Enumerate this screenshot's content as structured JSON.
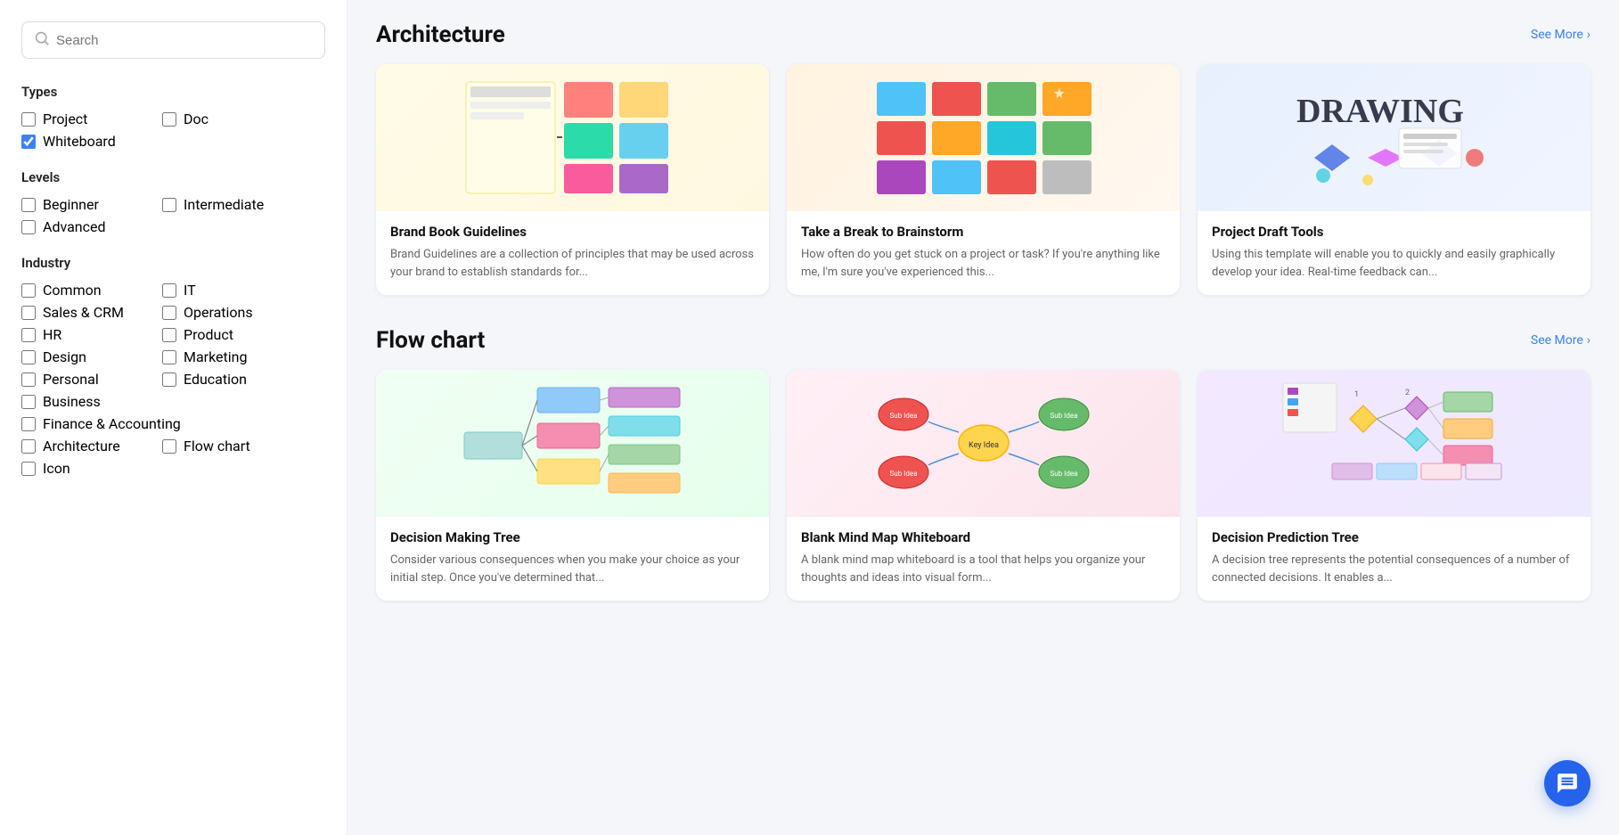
{
  "search": {
    "placeholder": "Search"
  },
  "sidebar": {
    "types_title": "Types",
    "levels_title": "Levels",
    "industry_title": "Industry",
    "types": [
      {
        "id": "project",
        "label": "Project",
        "checked": false
      },
      {
        "id": "doc",
        "label": "Doc",
        "checked": false
      },
      {
        "id": "whiteboard",
        "label": "Whiteboard",
        "checked": true
      }
    ],
    "levels": [
      {
        "id": "beginner",
        "label": "Beginner",
        "checked": false
      },
      {
        "id": "intermediate",
        "label": "Intermediate",
        "checked": false
      },
      {
        "id": "advanced",
        "label": "Advanced",
        "checked": false
      }
    ],
    "industry_col1": [
      {
        "id": "common",
        "label": "Common",
        "checked": false
      },
      {
        "id": "sales_crm",
        "label": "Sales & CRM",
        "checked": false
      },
      {
        "id": "hr",
        "label": "HR",
        "checked": false
      },
      {
        "id": "design",
        "label": "Design",
        "checked": false
      },
      {
        "id": "personal",
        "label": "Personal",
        "checked": false
      },
      {
        "id": "business",
        "label": "Business",
        "checked": false
      },
      {
        "id": "finance",
        "label": "Finance & Accounting",
        "checked": false
      },
      {
        "id": "architecture",
        "label": "Architecture",
        "checked": false
      },
      {
        "id": "icon",
        "label": "Icon",
        "checked": false
      }
    ],
    "industry_col2": [
      {
        "id": "it",
        "label": "IT",
        "checked": false
      },
      {
        "id": "operations",
        "label": "Operations",
        "checked": false
      },
      {
        "id": "product",
        "label": "Product",
        "checked": false
      },
      {
        "id": "marketing",
        "label": "Marketing",
        "checked": false
      },
      {
        "id": "education",
        "label": "Education",
        "checked": false
      },
      {
        "id": "flowchart",
        "label": "Flow chart",
        "checked": false
      }
    ]
  },
  "sections": [
    {
      "id": "architecture",
      "title": "Architecture",
      "see_more": "See More",
      "cards": [
        {
          "id": "brand-book",
          "title": "Brand Book Guidelines",
          "description": "Brand Guidelines are a collection of principles that may be used across your brand to establish standards for...",
          "image_type": "brand-book"
        },
        {
          "id": "brainstorm",
          "title": "Take a Break to Brainstorm",
          "description": "How often do you get stuck on a project or task? If you're anything like me, I'm sure you've experienced this...",
          "image_type": "brainstorm"
        },
        {
          "id": "project-draft",
          "title": "Project Draft Tools",
          "description": "Using this template will enable you to quickly and easily graphically develop your idea. Real-time feedback can...",
          "image_type": "project-draft"
        }
      ]
    },
    {
      "id": "flowchart",
      "title": "Flow chart",
      "see_more": "See More",
      "cards": [
        {
          "id": "decision-tree",
          "title": "Decision Making Tree",
          "description": "Consider various consequences when you make your choice as your initial step. Once you've determined that...",
          "image_type": "decision-tree"
        },
        {
          "id": "mind-map",
          "title": "Blank Mind Map Whiteboard",
          "description": "A blank mind map whiteboard is a tool that helps you organize your thoughts and ideas into visual form...",
          "image_type": "mind-map"
        },
        {
          "id": "prediction-tree",
          "title": "Decision Prediction Tree",
          "description": "A decision tree represents the potential consequences of a number of connected decisions. It enables a...",
          "image_type": "prediction-tree"
        }
      ]
    }
  ],
  "chat_button": {
    "label": "Chat"
  }
}
